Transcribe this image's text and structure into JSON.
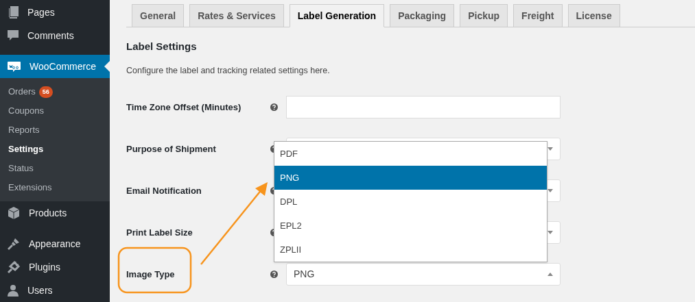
{
  "sidebar": {
    "items": [
      {
        "label": "Pages",
        "selected": false
      },
      {
        "label": "Comments",
        "selected": false
      },
      {
        "label": "WooCommerce",
        "selected": true,
        "children": [
          {
            "label": "Orders",
            "badge": "56",
            "selected": false
          },
          {
            "label": "Coupons",
            "selected": false
          },
          {
            "label": "Reports",
            "selected": false
          },
          {
            "label": "Settings",
            "selected": true
          },
          {
            "label": "Status",
            "selected": false
          },
          {
            "label": "Extensions",
            "selected": false
          }
        ]
      },
      {
        "label": "Products",
        "selected": false
      },
      {
        "label": "Appearance",
        "selected": false
      },
      {
        "label": "Plugins",
        "selected": false
      },
      {
        "label": "Users",
        "selected": false
      }
    ]
  },
  "tabs": [
    {
      "label": "General",
      "selected": false
    },
    {
      "label": "Rates & Services",
      "selected": false
    },
    {
      "label": "Label Generation",
      "selected": true
    },
    {
      "label": "Packaging",
      "selected": false
    },
    {
      "label": "Pickup",
      "selected": false
    },
    {
      "label": "Freight",
      "selected": false
    },
    {
      "label": "License",
      "selected": false
    }
  ],
  "section": {
    "title": "Label Settings",
    "description": "Configure the label and tracking related settings here."
  },
  "fields": [
    {
      "label": "Time Zone Offset (Minutes)",
      "kind": "text"
    },
    {
      "label": "Purpose of Shipment",
      "kind": "select",
      "expanded": false
    },
    {
      "label": "Email Notification",
      "kind": "select",
      "expanded": false
    },
    {
      "label": "Print Label Size",
      "kind": "select",
      "expanded": false
    },
    {
      "label": "Image Type",
      "kind": "select",
      "value": "PNG",
      "expanded": true,
      "options": [
        {
          "label": "PDF",
          "selected": false
        },
        {
          "label": "PNG",
          "selected": true
        },
        {
          "label": "DPL",
          "selected": false
        },
        {
          "label": "EPL2",
          "selected": false
        },
        {
          "label": "ZPLII",
          "selected": false
        }
      ]
    }
  ]
}
